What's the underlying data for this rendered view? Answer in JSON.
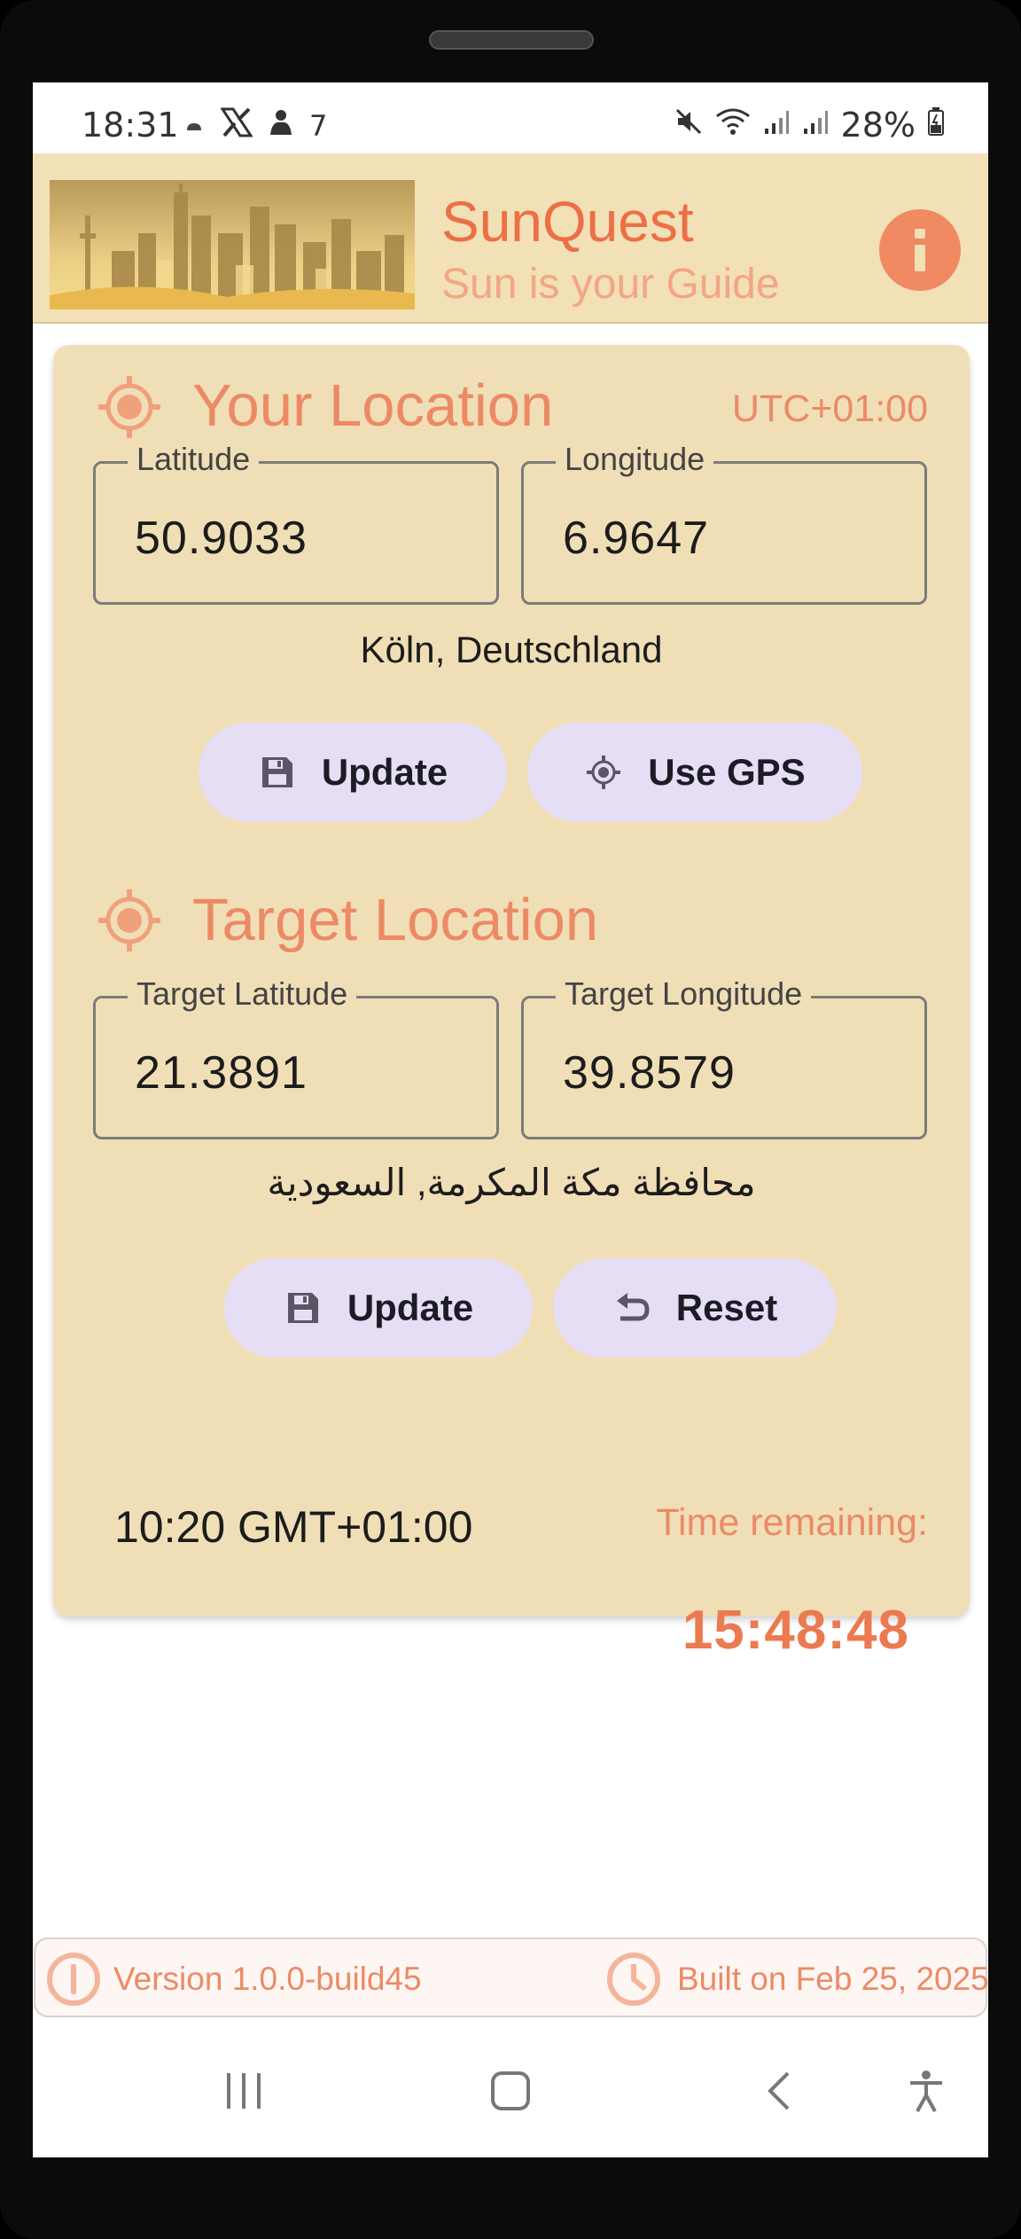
{
  "status_bar": {
    "time": "18:31",
    "notification_count": "7",
    "battery": "28%",
    "left_icons": [
      "cloud-icon",
      "x-icon",
      "notification-icon"
    ],
    "right_icons": [
      "mute-icon",
      "wifi-icon",
      "signal-icon",
      "signal-icon",
      "battery-icon"
    ]
  },
  "app": {
    "title": "SunQuest",
    "subtitle": "Sun is your Guide",
    "header_icon": "city-skyline-image",
    "info_icon": "info-icon",
    "accent_color": "#ec6f45",
    "background_color": "#f2e0b6"
  },
  "your_location": {
    "title": "Your Location",
    "utc_offset": "UTC+01:00",
    "latitude_label": "Latitude",
    "latitude_value": "50.9033",
    "longitude_label": "Longitude",
    "longitude_value": "6.9647",
    "place_name": "Köln, Deutschland",
    "update_label": "Update",
    "gps_label": "Use GPS"
  },
  "target_location": {
    "title": "Target Location",
    "latitude_label": "Target Latitude",
    "latitude_value": "21.3891",
    "longitude_label": "Target Longitude",
    "longitude_value": "39.8579",
    "place_name": "محافظة مكة المكرمة, السعودية",
    "update_label": "Update",
    "reset_label": "Reset"
  },
  "timer": {
    "target_time": "10:20 GMT+01:00",
    "remaining_label": "Time remaining:",
    "remaining_value": "15:48:48"
  },
  "footer": {
    "version": "Version 1.0.0-build45",
    "built_on": "Built on Feb 25, 2025"
  },
  "nav_bar": {
    "icons": [
      "recent-apps-icon",
      "home-icon",
      "back-icon",
      "accessibility-icon"
    ]
  }
}
